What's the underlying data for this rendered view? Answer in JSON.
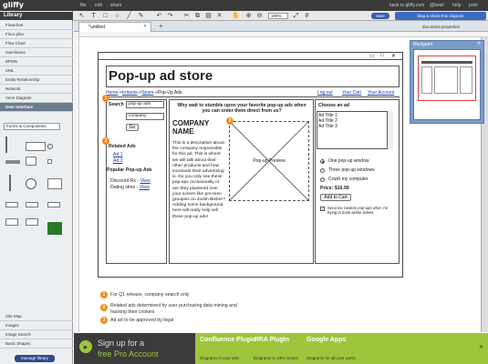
{
  "app": {
    "logo": "gliffy"
  },
  "menu": [
    "file",
    "edit",
    "share"
  ],
  "top_right": {
    "back": "back to gliffy.com",
    "account": "@beail",
    "help": "help",
    "print": "print"
  },
  "toolbar": {
    "zoom": "100%",
    "save": "save",
    "blog_share": "blog & share this diagram"
  },
  "sidebar": {
    "header": "Library",
    "items": [
      "Flowchart",
      "Floor plan",
      "Flow Chart",
      "Swimlanes",
      "BPMN",
      "UML",
      "Entity-Relationship",
      "Network",
      "Venn Diagram",
      "User Interface"
    ],
    "selected": "User Interface",
    "forms_select": "Forms & Components",
    "bottom_items": [
      "Site Map",
      "Images",
      "Image Search",
      "Basic Shapes"
    ],
    "manage": "manage library"
  },
  "tabs": {
    "active": "*untitled",
    "doc_props": "document properties"
  },
  "wireframe": {
    "title": "Pop-up ad store",
    "breadcrumb": {
      "home": "Home",
      "irritants": "Irritants",
      "spam": "Spam",
      "current": "Pop-Up Ads"
    },
    "top_links": [
      "Log out",
      "Your Cart",
      "Your Account"
    ],
    "search": {
      "label": "Search",
      "select": "pop-up ads",
      "input": "company",
      "go": "Go"
    },
    "related": {
      "title": "Related Ads",
      "links": [
        "Ad 1",
        "Ad 2"
      ]
    },
    "popular": {
      "title": "Popular Pop-up Ads",
      "items": [
        {
          "text": "Discount Rx -",
          "link": "View"
        },
        {
          "text": "Dating sites -",
          "link": "View"
        }
      ]
    },
    "headline": "Why wait to stumble upon your favorite pop-up ads when you can order them direct from us?",
    "company": "COMPANY NAME",
    "description": "This is a description about the company responsible for this ad. This is where we will talk about their other products and how incessant their advertising is. Do you only see these pop-ups occasionally or are they plastered over your screen like pre-teen groupies on Justin Bieber? Adding some background here will really help sell these pop-up ads!",
    "preview": "Pop-up Preview",
    "choose": {
      "title": "Choose an ad",
      "list": [
        "Ad Title 1",
        "Ad Title 2",
        "Ad Title 3"
      ]
    },
    "options": [
      "One pop-up window",
      "Three pop-up windows",
      "Crash my computer"
    ],
    "price": "Price: $16.99",
    "add_cart": "Add to Cart",
    "checkbox_text": "Send me random pop-ups when I'm trying to book airline tickets"
  },
  "notes": [
    {
      "num": "1",
      "text": "For Q1 release, company search only"
    },
    {
      "num": "2",
      "text": "Related ads determined by user purchasing data mining and hacking their cookies"
    },
    {
      "num": "3",
      "text": "Ad art to be approved by legal"
    }
  ],
  "navigator": {
    "title": "Navigator"
  },
  "banner": {
    "signup1": "Sign up for a",
    "signup2": "free Pro Account",
    "cols": [
      {
        "title": "Confluence Plugin",
        "sub": "Diagrams in your wiki"
      },
      {
        "title": "JIRA Plugin",
        "sub": "Diagrams in JIRA issues"
      },
      {
        "title": "Google Apps",
        "sub": "Diagrams for all your users"
      }
    ]
  },
  "colors": {
    "accent": "#f28a1e",
    "banner": "#9fc53c",
    "link": "#1a3fa6"
  }
}
